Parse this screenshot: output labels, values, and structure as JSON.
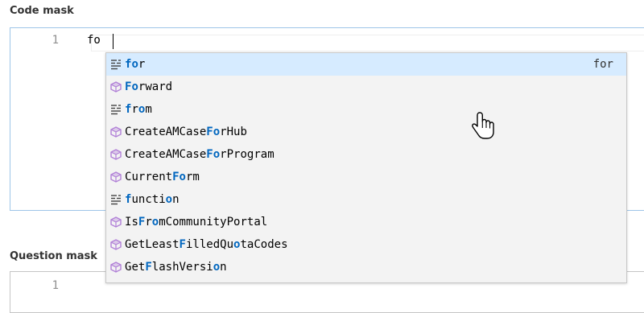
{
  "code_mask": {
    "label": "Code mask",
    "line_number": "1",
    "text": "fo"
  },
  "question_mask": {
    "label": "Question mask",
    "line_number": "1"
  },
  "suggest": {
    "items": [
      {
        "kind": "keyword",
        "icon": "keyword-icon",
        "label": "for",
        "match": "for",
        "detail": "for",
        "selected": true
      },
      {
        "kind": "class",
        "icon": "cube-icon",
        "label": "Forward",
        "match": "Fo"
      },
      {
        "kind": "keyword",
        "icon": "keyword-icon",
        "label": "from",
        "match": "fo"
      },
      {
        "kind": "class",
        "icon": "cube-icon",
        "label": "CreateAMCaseForHub",
        "match": "Fo"
      },
      {
        "kind": "class",
        "icon": "cube-icon",
        "label": "CreateAMCaseForProgram",
        "match": "Fo"
      },
      {
        "kind": "class",
        "icon": "cube-icon",
        "label": "CurrentForm",
        "match": "Fo"
      },
      {
        "kind": "keyword",
        "icon": "keyword-icon",
        "label": "function",
        "match": "fo"
      },
      {
        "kind": "class",
        "icon": "cube-icon",
        "label": "IsFromCommunityPortal",
        "match": "Fo"
      },
      {
        "kind": "class",
        "icon": "cube-icon",
        "label": "GetLeastFilledQuotaCodes",
        "match": "Fo"
      },
      {
        "kind": "class",
        "icon": "cube-icon",
        "label": "GetFlashVersion",
        "match": "Fo"
      }
    ]
  },
  "colors": {
    "match_highlight": "#0066bf",
    "selected_row": "#d6ebff",
    "cube_icon": "#b180d7",
    "keyword_icon": "#424242"
  }
}
